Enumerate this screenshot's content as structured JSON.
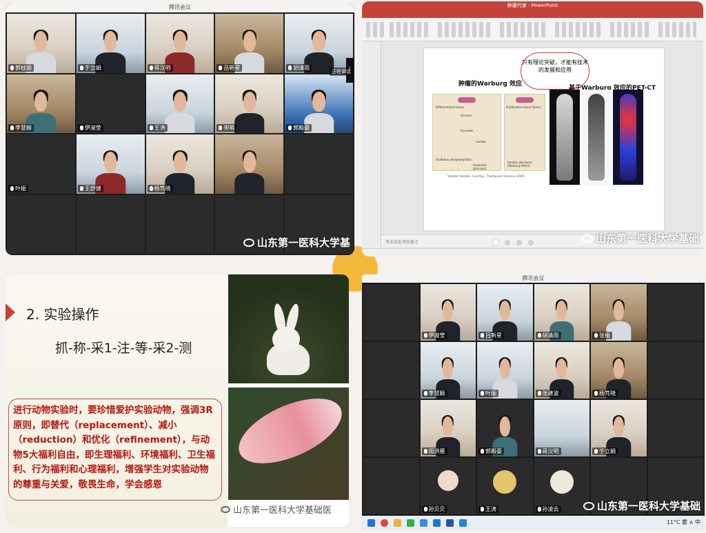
{
  "meeting_top": {
    "title": "腾讯会议",
    "participants": [
      "郭桂丽",
      "于立娟",
      "蒋汉明",
      "吕新星",
      "胡清雨",
      "李慧颖",
      "伊淑莹",
      "王涛",
      "宋萌",
      "郭殿豪",
      "叶振",
      "王舒健",
      "杨笃晓"
    ],
    "side_tag": "正在讲话",
    "watermark": "山东第一医科大学基"
  },
  "powerpoint": {
    "app_title": "肿瘤代谢 - PowerPoint",
    "slide": {
      "bubble_text": "只有理论突破，才能有技术的发展和应用",
      "heading_left": "肿瘤的Warburg 效应",
      "heading_right": "基于Warburg 效应的PET-CT",
      "diagram_labels": [
        "Differentiated tissue",
        "Proliferative tissue",
        "Tumor",
        "Glucose",
        "Pyruvate",
        "Lactate",
        "Oxidative phosphorylation",
        "Anaerobic glycolysis",
        "Aerobic glycolysis (Warburg effect)"
      ],
      "citation": "Vander Heiden, Cantley, Thompson Science 2009"
    },
    "notes_placeholder": "单击此处添加备注",
    "watermark": "山东第一医科大学基础"
  },
  "slide_bottom_left": {
    "heading": "2. 实验操作",
    "steps": "抓-称-采1-注-等-采2-测",
    "paragraph": "进行动物实验时，要珍惜爱护实验动物，强调3R原则，即替代（replacement）、减小（reduction）和优化（refinement），与动物5大福利自由，即生理福利、环境福利、卫生福利、行为福利和心理福利，增强学生对实验动物的尊重与关爱，敬畏生命，学会感恩",
    "watermark": "山东第一医科大学基础医"
  },
  "meeting_bottom": {
    "title": "腾讯会议",
    "participants": [
      "伊淑莹",
      "吕新星",
      "胡清雨",
      "张振",
      "李慧颖",
      "叶振",
      "张建波",
      "杨笃晓",
      "田洪雁",
      "郭殿豪",
      "蒋汉明",
      "于立娟",
      "孙贝贝",
      "王涛",
      "孙凌云"
    ],
    "watermark": "山东第一医科大学基础",
    "taskbar_right": "11°C 雾  ∧  中"
  },
  "colors": {
    "orange_dot": "#f4b93a",
    "ppt_red": "#c4423a",
    "text_red": "#b5180f"
  }
}
